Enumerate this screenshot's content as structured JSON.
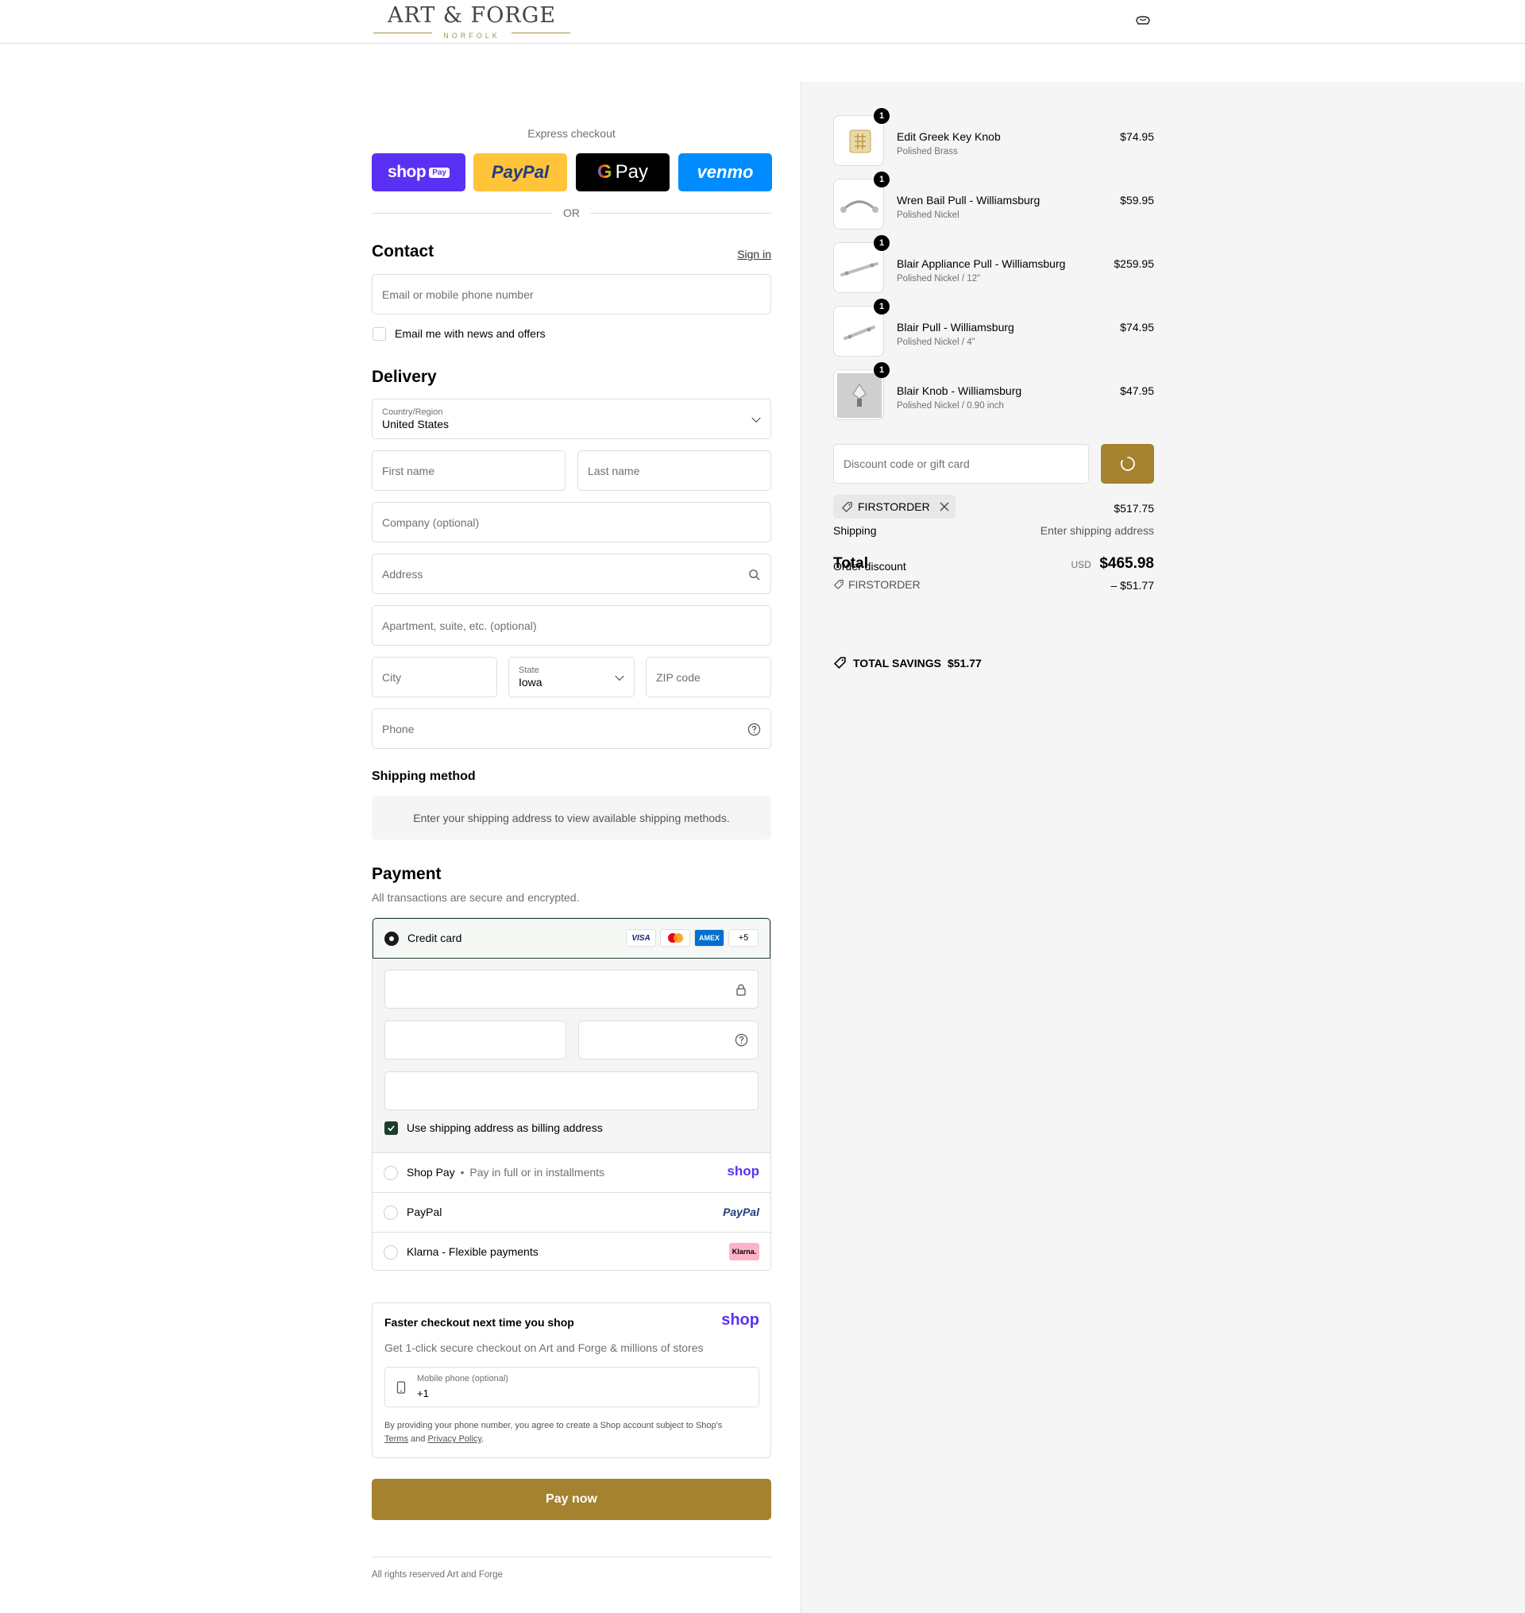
{
  "brand": {
    "name": "ART & FORGE",
    "location": "NORFOLK"
  },
  "colors": {
    "accent": "#a4822f",
    "shop_pay": "#5a31f4",
    "paypal": "#ffc439",
    "venmo": "#008cff",
    "gpay": "#000000"
  },
  "header": {
    "cart_icon": "cart-icon"
  },
  "express": {
    "title": "Express checkout",
    "shop_pay_label": "shop",
    "shop_pay_badge": "Pay",
    "paypal_label": "PayPal",
    "gpay_label": "Pay",
    "venmo_label": "venmo",
    "or": "OR"
  },
  "contact": {
    "title": "Contact",
    "sign_in": "Sign in",
    "email_placeholder": "Email or mobile phone number",
    "news_label": "Email me with news and offers"
  },
  "delivery": {
    "title": "Delivery",
    "country_label": "Country/Region",
    "country_value": "United States",
    "first_name": "First name",
    "last_name": "Last name",
    "company": "Company (optional)",
    "address": "Address",
    "apartment": "Apartment, suite, etc. (optional)",
    "city": "City",
    "state_label": "State",
    "state_value": "Iowa",
    "zip": "ZIP code",
    "phone": "Phone"
  },
  "shipping_method": {
    "title": "Shipping method",
    "message": "Enter your shipping address to view available shipping methods."
  },
  "payment": {
    "title": "Payment",
    "subtitle": "All transactions are secure and encrypted.",
    "credit_card": "Credit card",
    "card_logos": [
      "VISA",
      "mastercard",
      "AMEX",
      "+5"
    ],
    "billing_same": "Use shipping address as billing address",
    "shop_pay": "Shop Pay",
    "shop_pay_desc": "Pay in full or in installments",
    "shop_pay_logo": "shop",
    "paypal": "PayPal",
    "paypal_logo": "PayPal",
    "klarna": "Klarna - Flexible payments",
    "klarna_logo": "Klarna."
  },
  "shop_promo": {
    "title": "Faster checkout next time you shop",
    "logo": "shop",
    "desc": "Get 1-click secure checkout on Art and Forge & millions of stores",
    "phone_label": "Mobile phone (optional)",
    "phone_value": "+1",
    "legal_1": "By providing your phone number, you agree to create a Shop account subject to Shop's",
    "terms": "Terms",
    "and": "and",
    "privacy": "Privacy Policy",
    "period": "."
  },
  "pay_now": "Pay now",
  "footer": "All rights reserved Art and Forge",
  "cart": {
    "items": [
      {
        "name": "Edit Greek Key Knob",
        "variant": "Polished Brass",
        "price": "$74.95",
        "qty": "1"
      },
      {
        "name": "Wren Bail Pull - Williamsburg",
        "variant": "Polished Nickel",
        "price": "$59.95",
        "qty": "1"
      },
      {
        "name": "Blair Appliance Pull - Williamsburg",
        "variant": "Polished Nickel / 12\"",
        "price": "$259.95",
        "qty": "1"
      },
      {
        "name": "Blair Pull - Williamsburg",
        "variant": "Polished Nickel / 4\"",
        "price": "$74.95",
        "qty": "1"
      },
      {
        "name": "Blair Knob - Williamsburg",
        "variant": "Polished Nickel / 0.90 inch",
        "price": "$47.95",
        "qty": "1"
      }
    ],
    "discount_placeholder": "Discount code or gift card",
    "applied_code": "FIRSTORDER",
    "subtotal": "$517.75",
    "shipping_label": "Shipping",
    "shipping_value": "Enter shipping address",
    "total_label": "Total",
    "order_discount_label": "Order discount",
    "currency": "USD",
    "total": "$465.98",
    "discount_code": "FIRSTORDER",
    "discount_amount": "– $51.77",
    "savings_label": "TOTAL SAVINGS",
    "savings_value": "$51.77"
  }
}
